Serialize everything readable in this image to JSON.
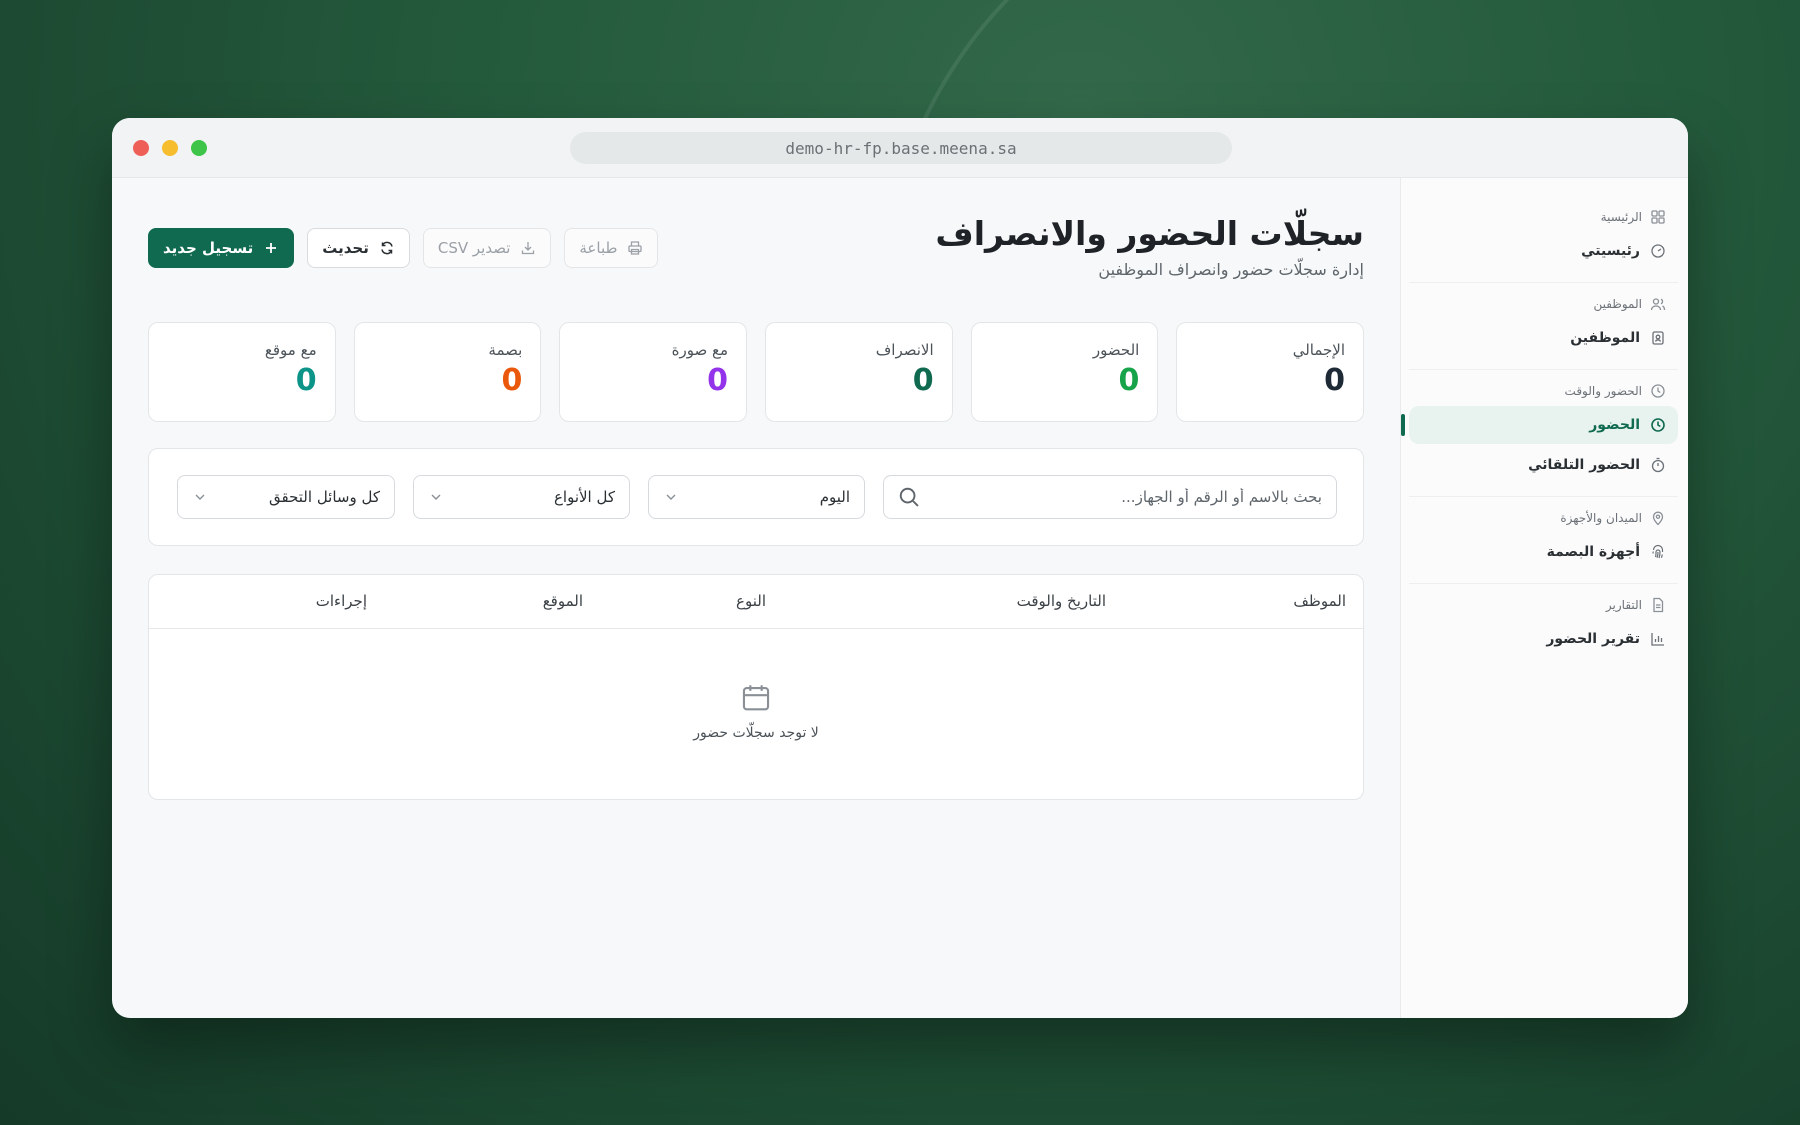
{
  "browser": {
    "url": "demo-hr-fp.base.meena.sa"
  },
  "sidebar": {
    "groups": [
      {
        "title": "الرئيسية",
        "icon": "grid-icon",
        "items": [
          {
            "label": "رئيسيتي",
            "icon": "gauge-icon"
          }
        ]
      },
      {
        "title": "الموظفين",
        "icon": "users-icon",
        "items": [
          {
            "label": "الموظفين",
            "icon": "id-badge-icon"
          }
        ]
      },
      {
        "title": "الحضور والوقت",
        "icon": "clock-icon",
        "items": [
          {
            "label": "الحضور",
            "icon": "clock-icon",
            "active": true
          },
          {
            "label": "الحضور التلقائي",
            "icon": "timer-icon"
          }
        ]
      },
      {
        "title": "الميدان والأجهزة",
        "icon": "map-pin-icon",
        "items": [
          {
            "label": "أجهزة البصمة",
            "icon": "fingerprint-icon"
          }
        ]
      },
      {
        "title": "التقارير",
        "icon": "file-icon",
        "items": [
          {
            "label": "تقرير الحضور",
            "icon": "bar-chart-icon"
          }
        ]
      }
    ]
  },
  "header": {
    "title": "سجلّات الحضور والانصراف",
    "subtitle": "إدارة سجلّات حضور وانصراف الموظفين"
  },
  "actions": {
    "new_record": "تسجيل جديد",
    "refresh": "تحديث",
    "export_csv": "تصدير CSV",
    "print": "طباعة"
  },
  "stats": [
    {
      "label": "الإجمالي",
      "value": "0",
      "color": "#1f2a37"
    },
    {
      "label": "الحضور",
      "value": "0",
      "color": "#16a34a"
    },
    {
      "label": "الانصراف",
      "value": "0",
      "color": "#0f6a4f"
    },
    {
      "label": "مع صورة",
      "value": "0",
      "color": "#9333ea"
    },
    {
      "label": "بصمة",
      "value": "0",
      "color": "#ea580c"
    },
    {
      "label": "مع موقع",
      "value": "0",
      "color": "#0d9488"
    }
  ],
  "filters": {
    "search_placeholder": "بحث بالاسم أو الرقم أو الجهاز...",
    "date": "اليوم",
    "type": "كل الأنواع",
    "verification": "كل وسائل التحقق"
  },
  "table": {
    "columns": [
      "الموظف",
      "التاريخ والوقت",
      "النوع",
      "الموقع",
      "إجراءات"
    ],
    "empty_text": "لا توجد سجلّات حضور"
  }
}
